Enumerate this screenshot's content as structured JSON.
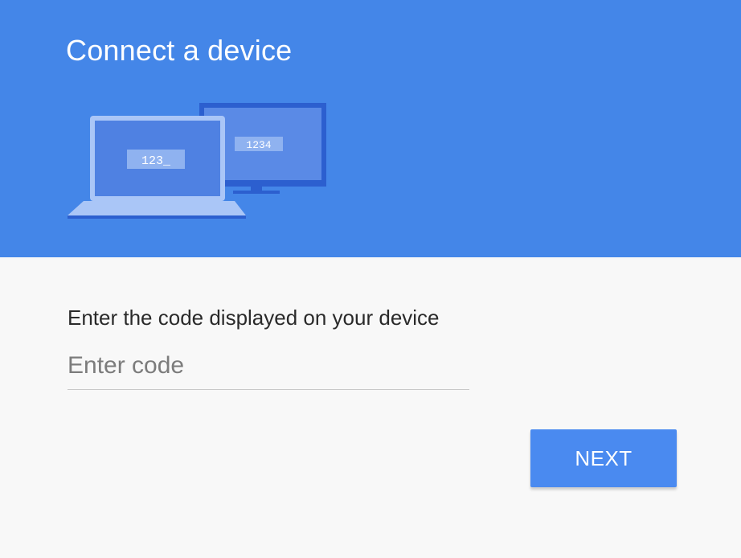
{
  "header": {
    "title": "Connect a device",
    "background_color": "#4486e8"
  },
  "illustration": {
    "laptop_screen_code": "123_",
    "tv_screen_code": "1234"
  },
  "form": {
    "prompt": "Enter the code displayed on your device",
    "code_input": {
      "value": "",
      "placeholder": "Enter code"
    },
    "next_label": "NEXT",
    "accent_color": "#4a8af0"
  }
}
